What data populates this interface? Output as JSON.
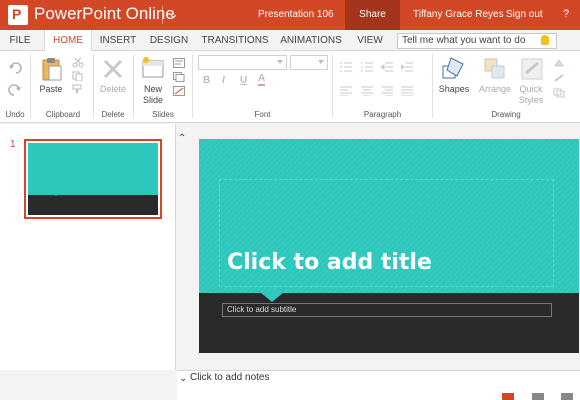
{
  "titlebar": {
    "app_name": "PowerPoint Online",
    "doc_title": "Presentation 106",
    "share": "Share",
    "user": "Tiffany Grace Reyes",
    "signout": "Sign out",
    "help": "?"
  },
  "tabs": [
    "FILE",
    "HOME",
    "INSERT",
    "DESIGN",
    "TRANSITIONS",
    "ANIMATIONS",
    "VIEW"
  ],
  "active_tab": "HOME",
  "tell_me": {
    "placeholder": "Tell me what you want to do"
  },
  "ribbon": {
    "undo_group": "Undo",
    "clipboard_group": "Clipboard",
    "paste": "Paste",
    "delete_group": "Delete",
    "delete": "Delete",
    "slides_group": "Slides",
    "new_slide_line1": "New",
    "new_slide_line2": "Slide",
    "font_group": "Font",
    "paragraph_group": "Paragraph",
    "drawing_group": "Drawing",
    "shapes": "Shapes",
    "arrange": "Arrange",
    "quick_styles_line1": "Quick",
    "quick_styles_line2": "Styles",
    "bold": "B",
    "italic": "I",
    "underline": "U",
    "font_color": "A"
  },
  "thumbnail": {
    "slide_number": "1"
  },
  "slide": {
    "title_placeholder": "Click to add title",
    "subtitle_placeholder": "Click to add subtitle"
  },
  "notes": {
    "placeholder": "Click to add notes"
  },
  "colors": {
    "accent": "#d24726",
    "share_bg": "#a5341c",
    "teal": "#2ec7bc",
    "dark": "#2a2a2a"
  }
}
